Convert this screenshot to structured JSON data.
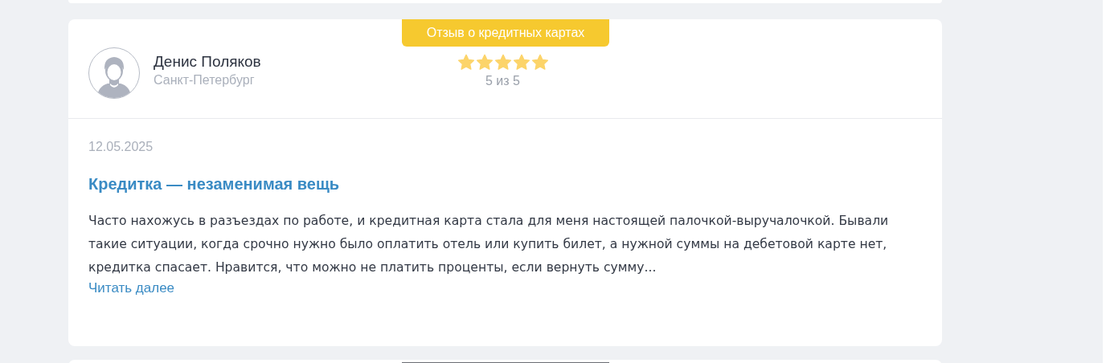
{
  "review": {
    "category": "Отзыв о кредитных картах",
    "author": {
      "name": "Денис Поляков",
      "city": "Санкт-Петербург"
    },
    "stars": 5,
    "rating_text": "5 из 5",
    "date": "12.05.2025",
    "title": "Кредитка — незаменимая вещь",
    "text": "Часто нахожусь в разъездах по работе, и кредитная карта стала для меня настоящей палочкой-выручалочкой. Бывали такие ситуации, когда срочно нужно было оплатить отель или купить билет, а нужной суммы на дебетовой карте нет, кредитка спасает. Нравится, что можно не платить проценты, если вернуть сумму...",
    "read_more": "Читать далее"
  }
}
